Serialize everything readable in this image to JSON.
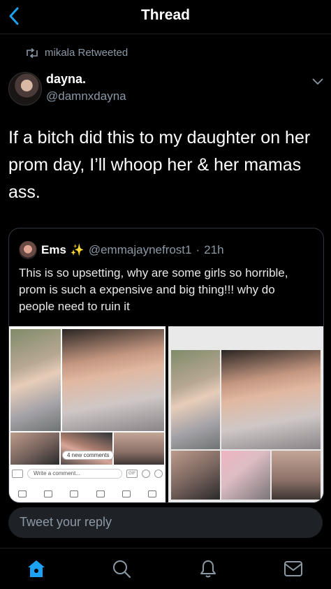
{
  "header": {
    "title": "Thread",
    "back_icon": "chevron-left-icon"
  },
  "retweet": {
    "icon": "retweet-icon",
    "text": "mikala Retweeted"
  },
  "author": {
    "name": "dayna.",
    "handle": "@damnxdayna",
    "avatar": "avatar-photo"
  },
  "tweet": {
    "text": "If a bitch did this to my daughter on her prom day, I’ll whoop her & her mamas ass."
  },
  "quote": {
    "name": "Ems",
    "emoji": "✨",
    "handle": "@emmajaynefrost1",
    "separator": "·",
    "time": "21h",
    "text": "This is so upsetting, why are some girls so horrible, prom is such a expensive and big thing!!! why do people need to ruin it",
    "screenshot": {
      "badge": "4 new comments",
      "comment_placeholder": "Write a comment...",
      "gif_label": "GIF"
    }
  },
  "reply_box": {
    "placeholder": "Tweet your reply"
  },
  "tabbar": {
    "items": [
      {
        "icon": "home-icon",
        "active": true
      },
      {
        "icon": "search-icon",
        "active": false
      },
      {
        "icon": "notifications-icon",
        "active": false
      },
      {
        "icon": "messages-icon",
        "active": false
      }
    ]
  },
  "colors": {
    "accent": "#1da1f2",
    "background": "#000000",
    "muted": "#8b98a5"
  }
}
